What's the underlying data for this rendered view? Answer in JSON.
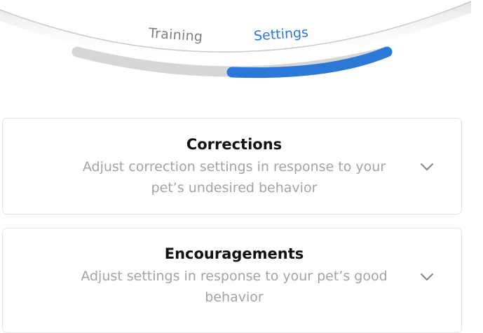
{
  "tabs": {
    "training_label": "Training",
    "settings_label": "Settings",
    "active": "Settings"
  },
  "colors": {
    "accent": "#2b78d6",
    "inactive_tab_text": "#7f7f7f",
    "track": "#d6d6d6",
    "card_border": "#e3e3e3",
    "title_text": "#111111",
    "description_text": "#a3a3a3"
  },
  "sections": [
    {
      "title": "Corrections",
      "description": "Adjust correction settings in response to your pet’s undesired behavior",
      "icon": "chevron-down-icon"
    },
    {
      "title": "Encouragements",
      "description": "Adjust settings in response to your pet’s good behavior",
      "icon": "chevron-down-icon"
    }
  ]
}
